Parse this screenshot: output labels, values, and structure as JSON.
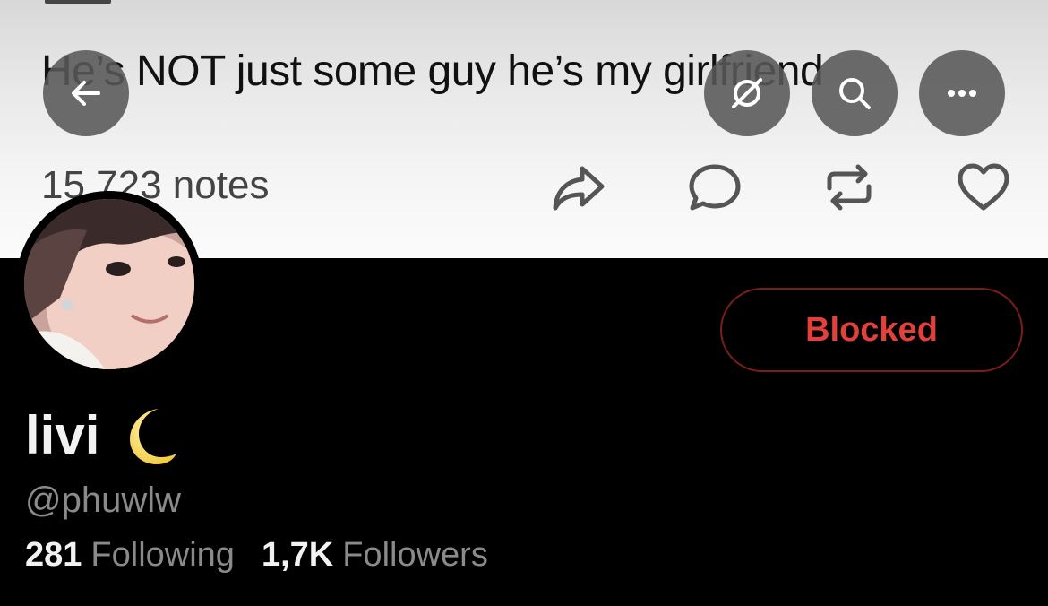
{
  "banner": {
    "quote_text": "He’s NOT just some guy he’s my girlfriend",
    "notes_text": "15,723 notes"
  },
  "nav": {
    "back_icon": "back-arrow-icon",
    "hide_icon": "eye-off-icon",
    "search_icon": "search-icon",
    "more_icon": "more-horizontal-icon"
  },
  "banner_actions": {
    "share_icon": "share-icon",
    "comment_icon": "comment-icon",
    "reblog_icon": "reblog-icon",
    "like_icon": "heart-icon"
  },
  "profile": {
    "display_name": "livi",
    "name_emoji": "crescent-moon-icon",
    "handle": "@phuwlw",
    "following_count": "281",
    "following_label": "Following",
    "followers_count": "1,7K",
    "followers_label": "Followers",
    "blocked_label": "Blocked"
  },
  "colors": {
    "background": "#000000",
    "blocked_text": "#e0413a",
    "blocked_border": "#7a1e1a",
    "muted_text": "#8a8a8a",
    "primary_text": "#f2f2f2",
    "nav_button": "#585858"
  }
}
